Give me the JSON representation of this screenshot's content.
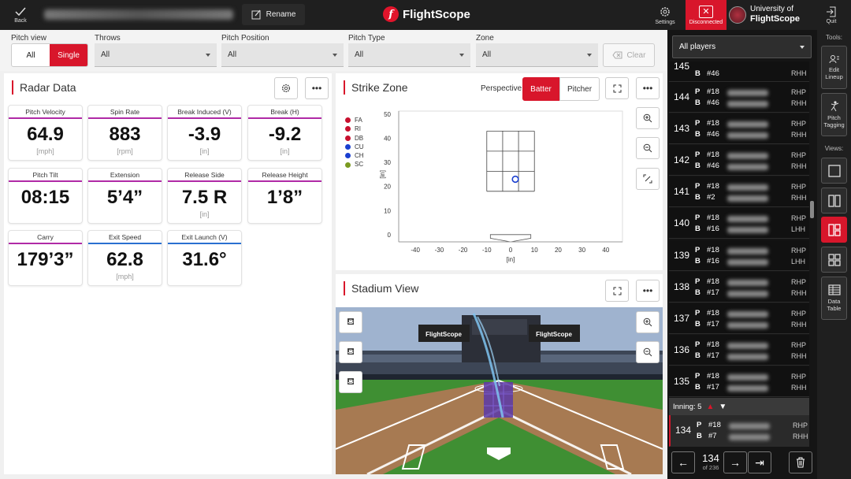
{
  "topbar": {
    "back_label": "Back",
    "rename_label": "Rename",
    "brand_name": "FlightScope",
    "settings_label": "Settings",
    "disconnected_label": "Disconnected",
    "univ_line1": "University of",
    "univ_line2": "FlightScope",
    "quit_label": "Quit"
  },
  "filters": {
    "pitch_view_label": "Pitch view",
    "pitch_view_options": [
      "All",
      "Single"
    ],
    "pitch_view_selected": "Single",
    "throws_label": "Throws",
    "throws_value": "All",
    "pitch_position_label": "Pitch Position",
    "pitch_position_value": "All",
    "pitch_type_label": "Pitch Type",
    "pitch_type_value": "All",
    "zone_label": "Zone",
    "zone_value": "All",
    "clear_label": "Clear"
  },
  "radar": {
    "title": "Radar Data",
    "metrics": [
      {
        "label": "Pitch Velocity",
        "value": "64.9",
        "unit": "[mph]"
      },
      {
        "label": "Spin Rate",
        "value": "883",
        "unit": "[rpm]"
      },
      {
        "label": "Break Induced (V)",
        "value": "-3.9",
        "unit": "[in]"
      },
      {
        "label": "Break (H)",
        "value": "-9.2",
        "unit": "[in]"
      },
      {
        "label": "Pitch Tilt",
        "value": "08:15",
        "unit": ""
      },
      {
        "label": "Extension",
        "value": "5’4”",
        "unit": ""
      },
      {
        "label": "Release Side",
        "value": "7.5 R",
        "unit": "[in]"
      },
      {
        "label": "Release Height",
        "value": "1’8”",
        "unit": ""
      },
      {
        "label": "Carry",
        "value": "179’3”",
        "unit": ""
      },
      {
        "label": "Exit Speed",
        "value": "62.8",
        "unit": "[mph]"
      },
      {
        "label": "Exit Launch (V)",
        "value": "31.6°",
        "unit": ""
      }
    ]
  },
  "strike_zone": {
    "title": "Strike Zone",
    "perspective_label": "Perspective",
    "batter_label": "Batter",
    "pitcher_label": "Pitcher",
    "legend": [
      {
        "code": "FA",
        "color": "#c8102e"
      },
      {
        "code": "RI",
        "color": "#c8102e"
      },
      {
        "code": "DB",
        "color": "#c8102e"
      },
      {
        "code": "CU",
        "color": "#1a3fd0"
      },
      {
        "code": "CH",
        "color": "#1a3fd0"
      },
      {
        "code": "SC",
        "color": "#7a9a20"
      }
    ],
    "y_unit": "[in]",
    "x_unit": "[in]",
    "x_ticks": [
      "-40",
      "-30",
      "-20",
      "-10",
      "0",
      "10",
      "20",
      "30",
      "40"
    ],
    "y_ticks": [
      "50",
      "40",
      "30",
      "20",
      "10",
      "0"
    ],
    "pitch_point": {
      "x": 2,
      "y": 23
    }
  },
  "stadium": {
    "title": "Stadium View",
    "sign_text": "FlightScope"
  },
  "side": {
    "filter_value": "All players",
    "partial_row_num": "145",
    "rows": [
      {
        "num": "144",
        "p": "P",
        "pn": "#18",
        "b": "B",
        "bn": "#46",
        "ph": "RHP",
        "bh": "RHH"
      },
      {
        "num": "143",
        "p": "P",
        "pn": "#18",
        "b": "B",
        "bn": "#46",
        "ph": "RHP",
        "bh": "RHH"
      },
      {
        "num": "142",
        "p": "P",
        "pn": "#18",
        "b": "B",
        "bn": "#46",
        "ph": "RHP",
        "bh": "RHH"
      },
      {
        "num": "141",
        "p": "P",
        "pn": "#18",
        "b": "B",
        "bn": "#2",
        "ph": "RHP",
        "bh": "RHH"
      },
      {
        "num": "140",
        "p": "P",
        "pn": "#18",
        "b": "B",
        "bn": "#16",
        "ph": "RHP",
        "bh": "LHH"
      },
      {
        "num": "139",
        "p": "P",
        "pn": "#18",
        "b": "B",
        "bn": "#16",
        "ph": "RHP",
        "bh": "LHH"
      },
      {
        "num": "138",
        "p": "P",
        "pn": "#18",
        "b": "B",
        "bn": "#17",
        "ph": "RHP",
        "bh": "RHH"
      },
      {
        "num": "137",
        "p": "P",
        "pn": "#18",
        "b": "B",
        "bn": "#17",
        "ph": "RHP",
        "bh": "RHH"
      },
      {
        "num": "136",
        "p": "P",
        "pn": "#18",
        "b": "B",
        "bn": "#17",
        "ph": "RHP",
        "bh": "RHH"
      },
      {
        "num": "135",
        "p": "P",
        "pn": "#18",
        "b": "B",
        "bn": "#17",
        "ph": "RHP",
        "bh": "RHH"
      }
    ],
    "inning_label": "Inning: 5",
    "selected_row": {
      "num": "134",
      "p": "P",
      "pn": "#18",
      "b": "B",
      "bn": "#7",
      "ph": "RHP",
      "bh": "RHH"
    },
    "nav_current": "134",
    "nav_total": "of 236"
  },
  "tools": {
    "tools_label": "Tools:",
    "edit_lineup_label": "Edit Lineup",
    "pitch_tagging_label": "Pitch Tagging",
    "views_label": "Views:",
    "data_table_label": "Data Table"
  },
  "colors": {
    "accent": "#d8162b",
    "metric_underline": "#b02aa6",
    "hit_underline": "#2a6fd0"
  }
}
